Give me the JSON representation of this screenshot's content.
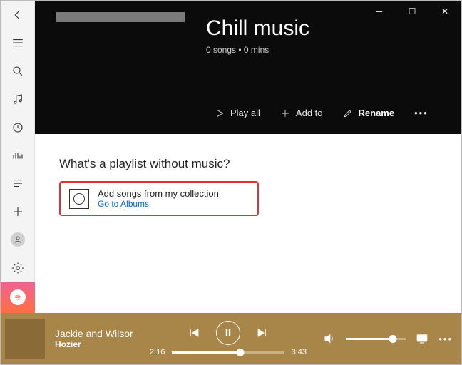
{
  "sidebar": {
    "items": [
      "back",
      "hamburger",
      "search",
      "music",
      "recent",
      "now-playing",
      "playlists",
      "add",
      "profile",
      "settings",
      "spotify"
    ]
  },
  "hero": {
    "title": "Chill music",
    "meta": "0 songs • 0 mins",
    "actions": {
      "play": "Play all",
      "addto": "Add to",
      "rename": "Rename"
    }
  },
  "body": {
    "heading": "What's a playlist without music?",
    "addcard": {
      "line1": "Add songs from my collection",
      "line2": "Go to Albums"
    }
  },
  "player": {
    "track": "Jackie and Wilsor",
    "artist": "Hozier",
    "elapsed": "2:16",
    "duration": "3:43",
    "progress_pct": 61,
    "volume_pct": 78
  }
}
